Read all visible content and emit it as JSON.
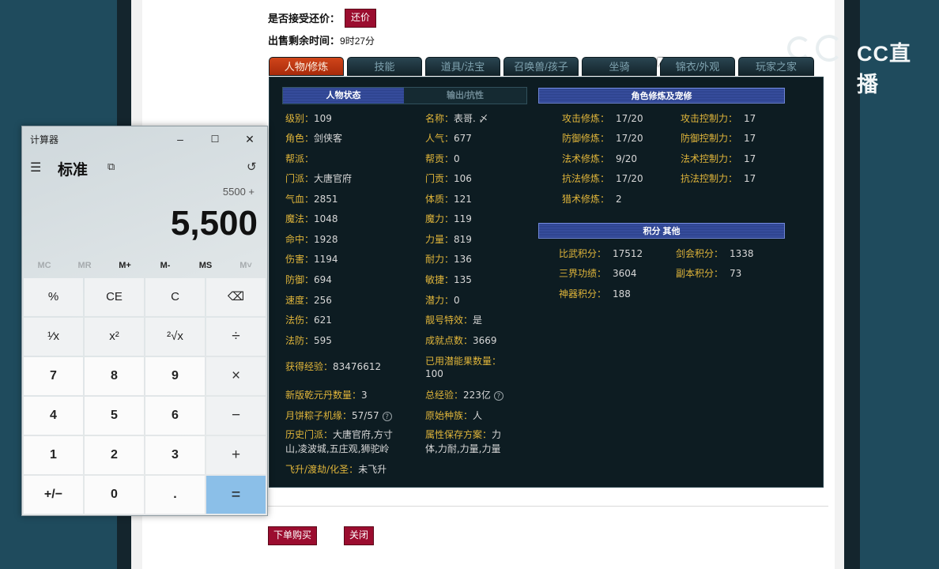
{
  "top": {
    "counter_offer_label": "是否接受还价：",
    "counter_offer_button": "还价",
    "time_left_label": "出售剩余时间：",
    "time_left_value": "9时27分"
  },
  "tabs": [
    "人物/修炼",
    "技能",
    "道具/法宝",
    "召唤兽/孩子",
    "坐骑",
    "锦衣/外观",
    "玩家之家"
  ],
  "subtabs": {
    "status": "人物状态",
    "output": "输出/抗性"
  },
  "stats_left": [
    {
      "k": "级别：",
      "v": "109"
    },
    {
      "k": "角色：",
      "v": "剑侠客"
    },
    {
      "k": "帮派：",
      "v": ""
    },
    {
      "k": "门派：",
      "v": "大唐官府"
    },
    {
      "k": "气血：",
      "v": "2851"
    },
    {
      "k": "魔法：",
      "v": "1048"
    },
    {
      "k": "命中：",
      "v": "1928"
    },
    {
      "k": "伤害：",
      "v": "1194"
    },
    {
      "k": "防御：",
      "v": "694"
    },
    {
      "k": "速度：",
      "v": "256"
    },
    {
      "k": "法伤：",
      "v": "621"
    },
    {
      "k": "法防：",
      "v": "595"
    },
    {
      "k": "获得经验：",
      "v": "83476612"
    },
    {
      "k": "新版乾元丹数量：",
      "v": "3"
    },
    {
      "k": "月饼粽子机缘：",
      "v": "57/57"
    }
  ],
  "stats_right": [
    {
      "k": "名称：",
      "v": "表哥. 〆"
    },
    {
      "k": "人气：",
      "v": "677"
    },
    {
      "k": "帮贡：",
      "v": "0"
    },
    {
      "k": "门贡：",
      "v": "106"
    },
    {
      "k": "体质：",
      "v": "121"
    },
    {
      "k": "魔力：",
      "v": "119"
    },
    {
      "k": "力量：",
      "v": "819"
    },
    {
      "k": "耐力：",
      "v": "136"
    },
    {
      "k": "敏捷：",
      "v": "135"
    },
    {
      "k": "潜力：",
      "v": "0"
    },
    {
      "k": "靓号特效：",
      "v": "是"
    },
    {
      "k": "成就点数：",
      "v": "3669"
    },
    {
      "k": "已用潜能果数量：",
      "v": "100"
    },
    {
      "k": "总经验：",
      "v": "223亿"
    },
    {
      "k": "原始种族：",
      "v": "人"
    }
  ],
  "history_school": {
    "k": "历史门派：",
    "v1": "大唐官府,方寸",
    "v2": "山,凌波城,五庄观,狮驼岭"
  },
  "attr_plan": {
    "k": "属性保存方案：",
    "v1": "力",
    "v2": "体,力耐,力量,力量"
  },
  "ascend": {
    "k": "飞升/渡劫/化圣：",
    "v": "未飞升"
  },
  "cultivation": {
    "title": "角色修炼及宠修",
    "rows": [
      {
        "k1": "攻击修炼：",
        "v1": "17/20",
        "k2": "攻击控制力：",
        "v2": "17"
      },
      {
        "k1": "防御修炼：",
        "v1": "17/20",
        "k2": "防御控制力：",
        "v2": "17"
      },
      {
        "k1": "法术修炼：",
        "v1": "9/20",
        "k2": "法术控制力：",
        "v2": "17"
      },
      {
        "k1": "抗法修炼：",
        "v1": "17/20",
        "k2": "抗法控制力：",
        "v2": "17"
      },
      {
        "k1": "猎术修炼：",
        "v1": "2",
        "k2": "",
        "v2": ""
      }
    ]
  },
  "points": {
    "title": "积分 其他",
    "rows": [
      {
        "k1": "比武积分：",
        "v1": "17512",
        "k2": "剑会积分：",
        "v2": "1338"
      },
      {
        "k1": "三界功绩：",
        "v1": "3604",
        "k2": "副本积分：",
        "v2": "73"
      },
      {
        "k1": "神器积分：",
        "v1": "188",
        "k2": "",
        "v2": ""
      }
    ]
  },
  "bottom": {
    "buy": "下单购买",
    "close": "关闭"
  },
  "logo": {
    "text": "CC直播"
  },
  "calculator": {
    "title": "计算器",
    "mode": "标准",
    "expression": "5500 +",
    "display": "5,500",
    "memory": [
      "MC",
      "MR",
      "M+",
      "M-",
      "MS",
      "M˅"
    ],
    "keys": [
      [
        "%",
        "CE",
        "C",
        "⌫"
      ],
      [
        "¹⁄x",
        "x²",
        "²√x",
        "÷"
      ],
      [
        "7",
        "8",
        "9",
        "×"
      ],
      [
        "4",
        "5",
        "6",
        "−"
      ],
      [
        "1",
        "2",
        "3",
        "+"
      ],
      [
        "+/−",
        "0",
        ".",
        "="
      ]
    ]
  }
}
